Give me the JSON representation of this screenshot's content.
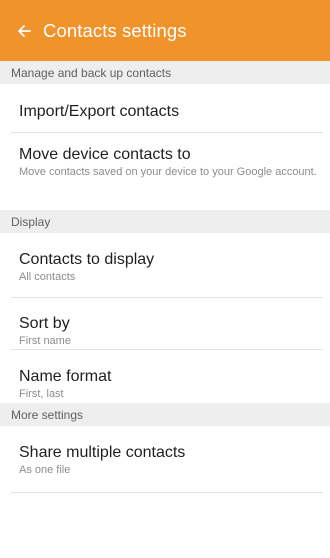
{
  "header": {
    "title": "Contacts settings",
    "back_icon": "arrow-left-icon",
    "color": "#f0932b"
  },
  "sections": [
    {
      "header": "Manage and back up contacts",
      "items": [
        {
          "title": "Import/Export contacts"
        },
        {
          "title": "Move device contacts to",
          "subtitle": "Move contacts saved on your device to your Google account."
        }
      ]
    },
    {
      "header": "Display",
      "items": [
        {
          "title": "Contacts to display",
          "subtitle": "All contacts"
        },
        {
          "title": "Sort by",
          "subtitle": "First name"
        },
        {
          "title": "Name format",
          "subtitle": "First, last"
        }
      ]
    },
    {
      "header": "More settings",
      "items": [
        {
          "title": "Share multiple contacts",
          "subtitle": "As one file"
        }
      ]
    }
  ]
}
